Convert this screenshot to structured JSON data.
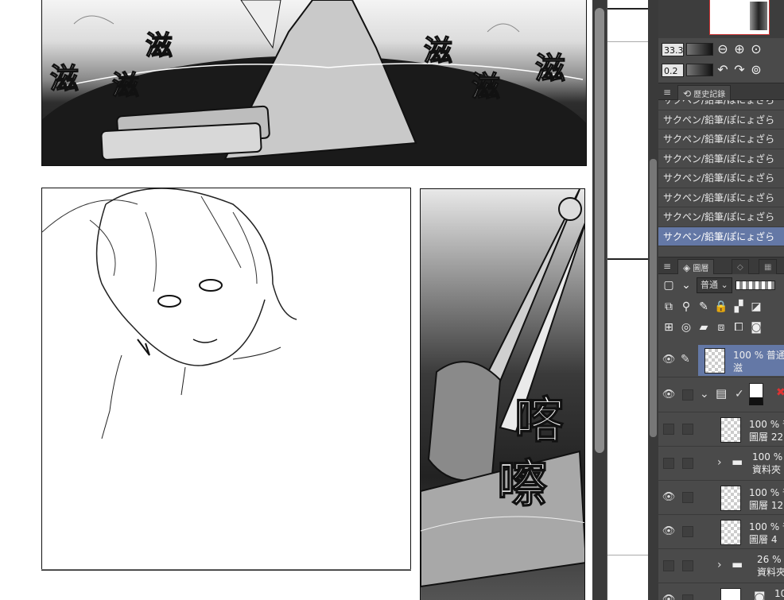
{
  "canvas": {
    "sfx_top": [
      "滋",
      "滋",
      "滋",
      "滋",
      "滋",
      "滋"
    ],
    "sfx_right": [
      "喀",
      "嚓"
    ]
  },
  "navigator": {
    "zoom_value": "33.3",
    "rotate_value": "0.2",
    "icons": [
      "zoom-out-icon",
      "zoom-in-icon",
      "fit-icon",
      "rotate-left-icon",
      "rotate-right-icon",
      "reset-rotation-icon"
    ]
  },
  "history_panel": {
    "tab_label": "歷史記錄",
    "items": [
      "サクペン/鉛筆/ぽにょざら",
      "サクペン/鉛筆/ぽにょざら",
      "サクペン/鉛筆/ぽにょざら",
      "サクペン/鉛筆/ぽにょざら",
      "サクペン/鉛筆/ぽにょざら",
      "サクペン/鉛筆/ぽにょざら",
      "サクペン/鉛筆/ぽにょざら",
      "サクペン/鉛筆/ぽにょざら"
    ],
    "selected_index": 7
  },
  "layer_panel": {
    "tab_label": "圖層",
    "blend_mode": "普通",
    "layers": [
      {
        "line1": "100 % 普通",
        "line2": "滋",
        "selected": true,
        "visible": true
      },
      {
        "line1": "",
        "line2": "",
        "selected": false,
        "visible": true
      },
      {
        "line1": "100 % 普",
        "line2": "圖層 22",
        "selected": false,
        "visible": false
      },
      {
        "line1": "100 %",
        "line2": "資料夾",
        "selected": false,
        "visible": false
      },
      {
        "line1": "100 % 普",
        "line2": "圖層 12",
        "selected": false,
        "visible": true
      },
      {
        "line1": "100 % 普",
        "line2": "圖層 4",
        "selected": false,
        "visible": true
      },
      {
        "line1": "26 %",
        "line2": "資料夾",
        "selected": false,
        "visible": false
      },
      {
        "line1": "10",
        "line2": "",
        "selected": false,
        "visible": true
      }
    ]
  },
  "colors": {
    "selection": "#6478a6",
    "panel_bg": "#4a4a4a",
    "dark_bar": "#3a3a3a"
  }
}
